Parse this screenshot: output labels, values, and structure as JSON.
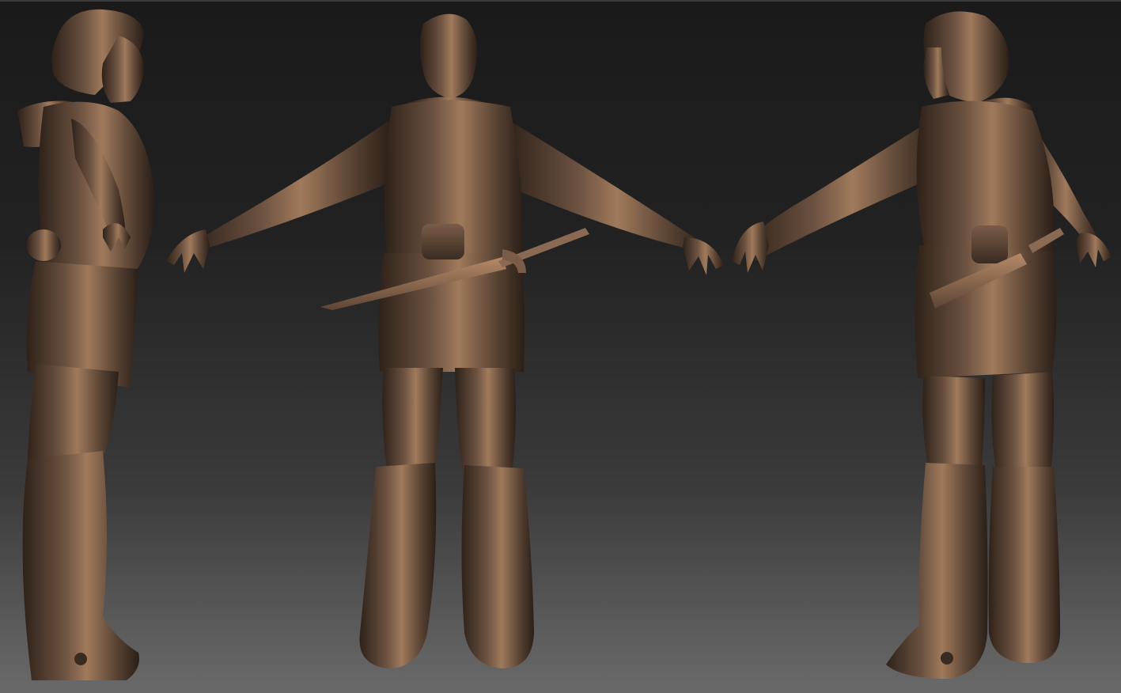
{
  "scene": {
    "background_top": "#1a1a1a",
    "background_bottom": "#6a6a6a",
    "material_base": "#5a4436",
    "material_highlight": "#a37c5e",
    "material_shadow": "#2a1f18"
  },
  "views": [
    {
      "name": "side-view"
    },
    {
      "name": "back-view"
    },
    {
      "name": "three-quarter-back-view"
    }
  ]
}
